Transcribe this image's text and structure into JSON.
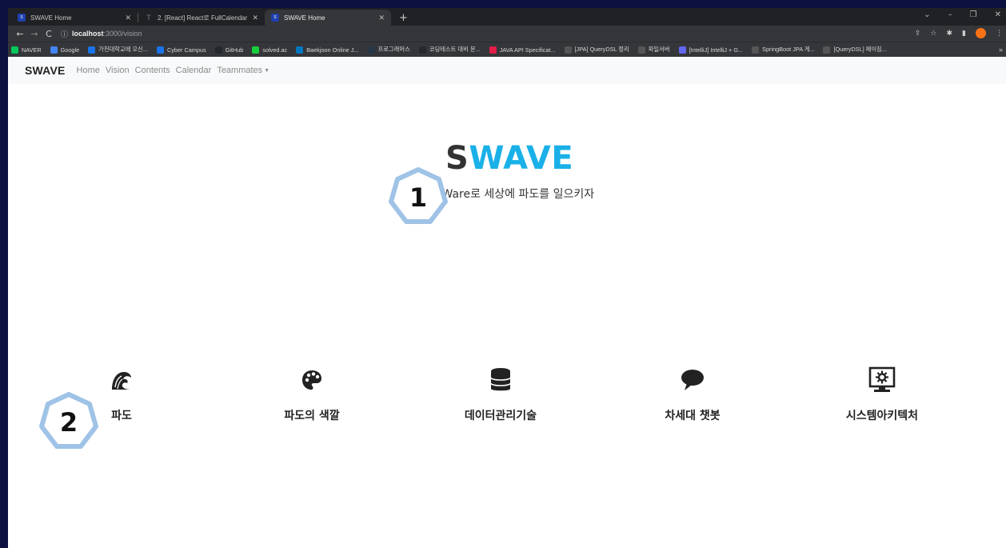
{
  "browser": {
    "tabs": [
      {
        "title": "SWAVE Home",
        "active": false
      },
      {
        "title": "2. [React] React로 FullCalendar",
        "active": false
      },
      {
        "title": "SWAVE Home",
        "active": true
      }
    ],
    "address": {
      "host": "localhost",
      "path": ":3000/vision"
    },
    "bookmarks": [
      {
        "label": "NAVER",
        "color": "#03c75a"
      },
      {
        "label": "Google",
        "color": "#4285f4"
      },
      {
        "label": "가천대학교에 오신...",
        "color": "#1a73e8"
      },
      {
        "label": "Cyber Campus",
        "color": "#1a73e8"
      },
      {
        "label": "GitHub",
        "color": "#24292f"
      },
      {
        "label": "solved.ac",
        "color": "#17ce3a"
      },
      {
        "label": "Baekjoon Online J...",
        "color": "#0076c0"
      },
      {
        "label": "프로그래머스",
        "color": "#263747"
      },
      {
        "label": "코딩테스트 대비 문...",
        "color": "#24292f"
      },
      {
        "label": "JAVA API Specificat...",
        "color": "#e11d48"
      },
      {
        "label": "[JPA] QueryDSL 정리",
        "color": "#555555"
      },
      {
        "label": "파일서버",
        "color": "#555555"
      },
      {
        "label": "[IntelliJ] IntelliJ + G...",
        "color": "#6366f1"
      },
      {
        "label": "SpringBoot JPA 게...",
        "color": "#555555"
      },
      {
        "label": "[QueryDSL] 페이징...",
        "color": "#555555"
      }
    ]
  },
  "site": {
    "brand": "SWAVE",
    "nav": [
      "Home",
      "Vision",
      "Contents",
      "Calendar",
      "Teammates"
    ],
    "hero": {
      "logo_first": "S",
      "logo_rest": "WAVE",
      "tagline": "SoftWare로 세상에 파도를 일으키자"
    },
    "badges": [
      {
        "number": "1"
      },
      {
        "number": "2"
      }
    ],
    "features": [
      {
        "label": "파도",
        "icon": "wave-icon"
      },
      {
        "label": "파도의 색깔",
        "icon": "palette-icon"
      },
      {
        "label": "데이터관리기술",
        "icon": "database-icon"
      },
      {
        "label": "차세대 챗봇",
        "icon": "chat-bubble-icon"
      },
      {
        "label": "시스템아키텍처",
        "icon": "monitor-gear-icon"
      }
    ]
  },
  "colors": {
    "accent": "#1ab0e8",
    "badge_stroke": "#9fc3e6",
    "frame": "#0d1140"
  }
}
